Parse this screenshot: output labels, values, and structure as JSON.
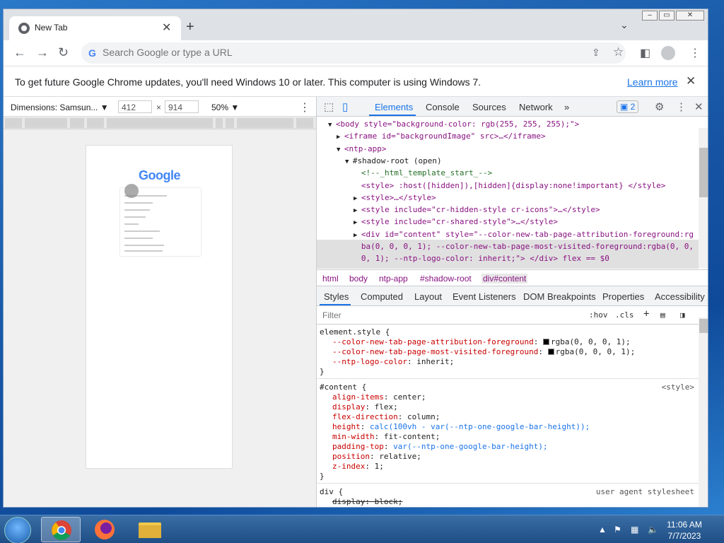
{
  "browser": {
    "tab_title": "New Tab",
    "omnibox_placeholder": "Search Google or type a URL",
    "infobar_message": "To get future Google Chrome updates, you'll need Windows 10 or later. This computer is using Windows 7.",
    "infobar_link": "Learn more"
  },
  "device_toolbar": {
    "dimensions_label": "Dimensions: Samsun...",
    "width": "412",
    "height": "914",
    "zoom": "50%"
  },
  "emulated_page": {
    "logo": "Google"
  },
  "devtools": {
    "tabs": [
      "Elements",
      "Console",
      "Sources",
      "Network"
    ],
    "issues_count": "2",
    "dom_lines": [
      {
        "indent": 0,
        "tri": "▼",
        "html": "<body style=\"background-color: rgb(255, 255, 255);\">"
      },
      {
        "indent": 1,
        "tri": "▶",
        "html": "<iframe id=\"backgroundImage\" src>…</iframe>"
      },
      {
        "indent": 1,
        "tri": "▼",
        "html": "<ntp-app>"
      },
      {
        "indent": 2,
        "tri": "▼",
        "html": "#shadow-root (open)"
      },
      {
        "indent": 3,
        "tri": "",
        "html": "<!--_html_template_start_-->"
      },
      {
        "indent": 3,
        "tri": "",
        "html": "<style> :host([hidden]),[hidden]{display:none!important} </style>"
      },
      {
        "indent": 3,
        "tri": "▶",
        "html": "<style>…</style>"
      },
      {
        "indent": 3,
        "tri": "▶",
        "html": "<style include=\"cr-hidden-style cr-icons\">…</style>"
      },
      {
        "indent": 3,
        "tri": "▶",
        "html": "<style include=\"cr-shared-style\">…</style>"
      },
      {
        "indent": 3,
        "tri": "▶",
        "html": "<div id=\"content\" style=\"--color-new-tab-page-attribution-foreground:rg"
      },
      {
        "indent": 3,
        "tri": "",
        "html": "ba(0, 0, 0, 1); --color-new-tab-page-most-visited-foreground:rgba(0, 0,"
      },
      {
        "indent": 3,
        "tri": "",
        "html": "0, 1); --ntp-logo-color: inherit;\"> </div> flex == $0"
      }
    ],
    "breadcrumbs": [
      "html",
      "body",
      "ntp-app",
      "#shadow-root",
      "div#content"
    ],
    "styles_tabs": [
      "Styles",
      "Computed",
      "Layout",
      "Event Listeners",
      "DOM Breakpoints",
      "Properties",
      "Accessibility"
    ],
    "filter_placeholder": "Filter",
    "filter_hov": ":hov",
    "filter_cls": ".cls",
    "rules": {
      "element_selector": "element.style {",
      "element_props": [
        {
          "name": "--color-new-tab-page-attribution-foreground",
          "value": "rgba(0, 0, 0, 1);"
        },
        {
          "name": "--color-new-tab-page-most-visited-foreground",
          "value": "rgba(0, 0, 0, 1);"
        },
        {
          "name": "--ntp-logo-color",
          "value": "inherit;"
        }
      ],
      "content_selector": "#content {",
      "content_source": "<style>",
      "content_props": [
        {
          "name": "align-items",
          "value": "center;"
        },
        {
          "name": "display",
          "value": "flex;"
        },
        {
          "name": "flex-direction",
          "value": "column;"
        },
        {
          "name": "height",
          "value": "calc(100vh - var(--ntp-one-google-bar-height));"
        },
        {
          "name": "min-width",
          "value": "fit-content;"
        },
        {
          "name": "padding-top",
          "value": "var(--ntp-one-google-bar-height);"
        },
        {
          "name": "position",
          "value": "relative;"
        },
        {
          "name": "z-index",
          "value": "1;"
        }
      ],
      "div_selector": "div {",
      "div_source": "user agent stylesheet",
      "div_props": [
        {
          "name": "display",
          "value": "block;"
        }
      ],
      "close_brace": "}"
    }
  },
  "taskbar": {
    "time": "11:06 AM",
    "date": "7/7/2023"
  },
  "colors": {
    "accent": "#1a73e8",
    "taskbar": "#1f4e86"
  }
}
